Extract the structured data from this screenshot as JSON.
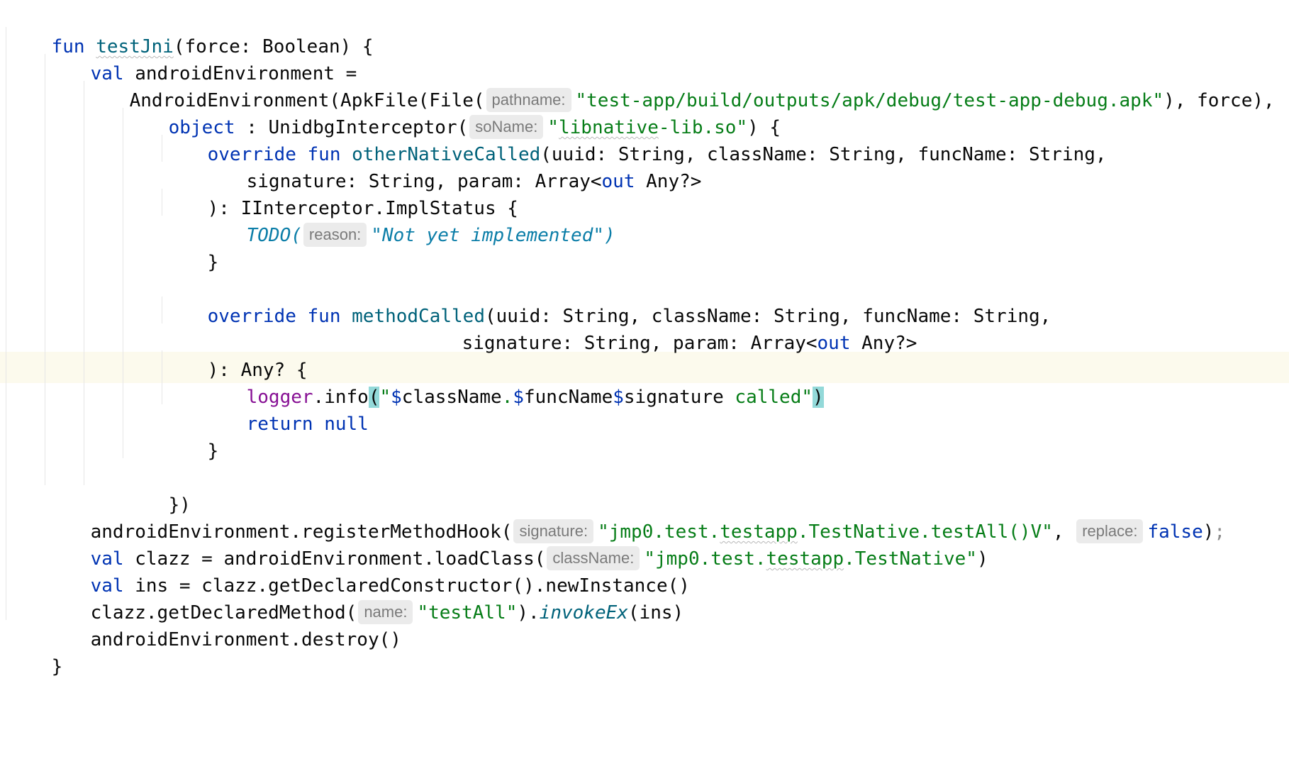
{
  "code": {
    "l1": {
      "kw": "fun",
      "fname": "testJni",
      "rest": "(force: Boolean) {"
    },
    "l2": {
      "kw": "val",
      "rest": " androidEnvironment ="
    },
    "l3": {
      "pre": "AndroidEnvironment(ApkFile(File(",
      "hint": "pathname:",
      "str": "\"test-app/build/outputs/apk/debug/test-app-debug.apk\"",
      "post": "), force),"
    },
    "l4": {
      "kw": "object",
      "pre": " : UnidbgInterceptor(",
      "hint": "soName:",
      "str_q1": "\"",
      "str_warn": "libnative",
      "str_rest": "-lib.so\"",
      "post": ") {"
    },
    "l5": {
      "kw1": "override",
      "kw2": "fun",
      "fname": "otherNativeCalled",
      "rest": "(uuid: String, className: String, funcName: String,"
    },
    "l6": {
      "pre": "signature: String, param: Array<",
      "kw": "out",
      "post": " Any?>"
    },
    "l7": {
      "text": "): IInterceptor.ImplStatus {"
    },
    "l8": {
      "todo": "TODO(",
      "hint": "reason:",
      "str": "\"Not yet implemented\")"
    },
    "l9": {
      "text": "}"
    },
    "l11": {
      "kw1": "override",
      "kw2": "fun",
      "fname": "methodCalled",
      "rest": "(uuid: String, className: String, funcName: String,"
    },
    "l12": {
      "pre": "signature: String, param: Array<",
      "kw": "out",
      "post": " Any?>"
    },
    "l13": {
      "text": "): Any? {"
    },
    "l14": {
      "logger": "logger",
      "dot": ".info",
      "lp": "(",
      "q": "\"",
      "d1": "$",
      "v1": "className",
      "s1": ".",
      "d2": "$",
      "v2": "funcName",
      "d3": "$",
      "v3": "signature",
      "s2": " called\"",
      "rp": ")"
    },
    "l15": {
      "kw1": "return",
      "kw2": "null"
    },
    "l16": {
      "text": "}"
    },
    "l18": {
      "text": "})"
    },
    "l19": {
      "pre": "androidEnvironment.registerMethodHook(",
      "hint1": "signature:",
      "str_a": "\"jmp0.test.",
      "str_warn": "testapp",
      "str_b": ".TestNative.testAll()V\"",
      "comma": ", ",
      "hint2": "replace:",
      "kw": "false",
      "close": ")",
      "semi": ";"
    },
    "l20": {
      "kw": "val",
      "pre": " clazz = androidEnvironment.loadClass(",
      "hint": "className:",
      "str_a": "\"jmp0.test.",
      "str_warn": "testapp",
      "str_b": ".TestNative\"",
      "post": ")"
    },
    "l21": {
      "kw": "val",
      "rest": " ins = clazz.getDeclaredConstructor().newInstance()"
    },
    "l22": {
      "pre": "clazz.getDeclaredMethod(",
      "hint": "name:",
      "str": "\"testAll\"",
      "mid": ").",
      "ital": "invokeEx",
      "post": "(ins)"
    },
    "l23": {
      "text": "androidEnvironment.destroy()"
    },
    "l24": {
      "text": "}"
    }
  },
  "colors": {
    "keyword": "#0033b3",
    "function": "#00627a",
    "string": "#067d17",
    "todo": "#0c7ea8",
    "property": "#871094",
    "caret_line": "#fcfaed",
    "brace_match": "#93d9d9",
    "hint_bg": "#ebebeb"
  }
}
